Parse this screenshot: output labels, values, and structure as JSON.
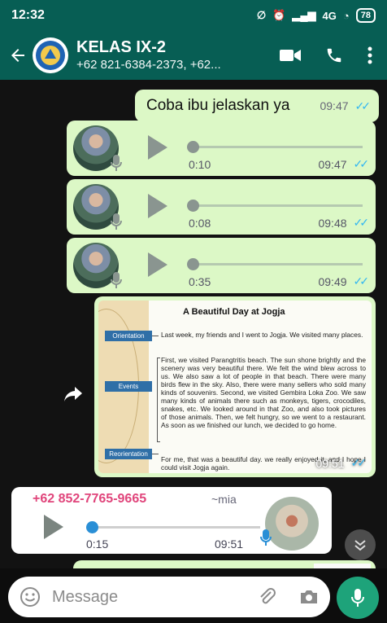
{
  "status_bar": {
    "time": "12:32",
    "network": "4G",
    "battery": "78"
  },
  "header": {
    "title": "KELAS IX-2",
    "subtitle": "+62 821-6384-2373, +62..."
  },
  "messages": {
    "text": {
      "body": "Coba ibu jelaskan ya",
      "time": "09:47"
    },
    "voice": [
      {
        "duration": "0:10",
        "time": "09:47"
      },
      {
        "duration": "0:08",
        "time": "09:48"
      },
      {
        "duration": "0:35",
        "time": "09:49"
      }
    ],
    "image": {
      "time": "09:51",
      "doc_title": "A Beautiful Day at Jogja",
      "tags": [
        "Orientation",
        "Events",
        "Reorientation"
      ],
      "paragraphs": [
        "Last week, my friends and I went to Jogja. We visited many places.",
        "First, we visited Parangtritis beach. The sun shone brightly and the scenery was very beautiful there. We felt the wind blew across to us. We also saw a lot of people in that beach. There were many birds flew in the sky. Also, there were many sellers who sold many kinds of souvenirs. Second, we visited Gembira Loka Zoo. We saw many kinds of animals there such as monkeys, tigers, crocodiles, snakes, etc. We looked around in that Zoo, and also took pictures of those animals. Then, we felt hungry, so we went to a restaurant. As soon as we finished our lunch, we decided to go home.",
        "For me, that was a beautiful day. we really enjoyed it, and I hope I could visit Jogja again."
      ]
    },
    "incoming_voice": {
      "sender": "+62 852-7765-9665",
      "alias": "~mia",
      "duration": "0:15",
      "time": "09:51"
    }
  },
  "input": {
    "placeholder": "Message"
  }
}
